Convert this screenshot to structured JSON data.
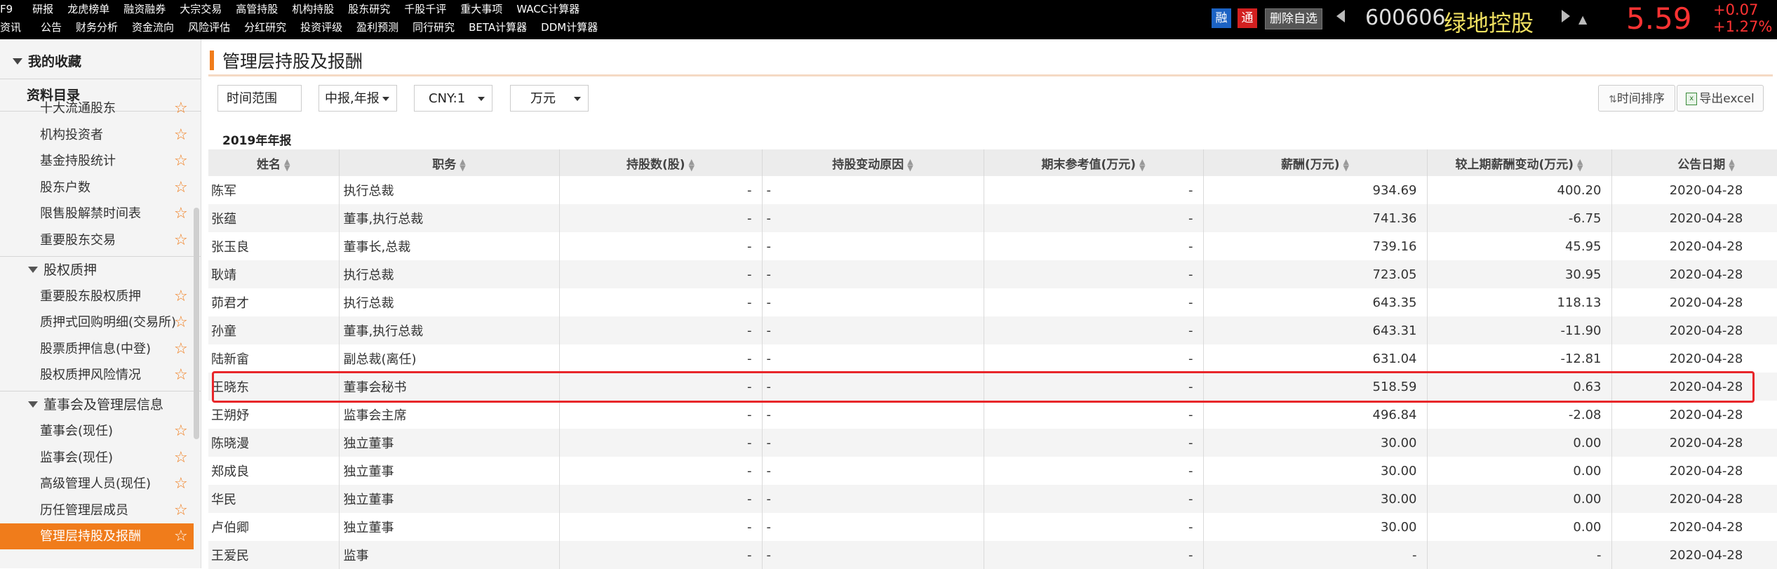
{
  "topbar": {
    "row1": [
      "F9",
      "研报",
      "龙虎榜单",
      "融资融券",
      "大宗交易",
      "高管持股",
      "机构持股",
      "股东研究",
      "千股千评",
      "重大事项",
      "WACC计算器"
    ],
    "row2": [
      "资讯",
      "公告",
      "财务分析",
      "资金流向",
      "风险评估",
      "分红研究",
      "投资评级",
      "盈利预测",
      "同行研究",
      "BETA计算器",
      "DDM计算器"
    ],
    "badge_rong": "融",
    "badge_tong": "通",
    "remove_watchlist": "删除自选",
    "stock_code": "600606",
    "stock_name": "绿地控股",
    "price": "5.59",
    "change_abs": "+0.07",
    "change_pct": "+1.27%"
  },
  "sidebar": {
    "favorites": "我的收藏",
    "catalog": "资料目录",
    "items_top": [
      "十大流通股东",
      "机构投资者",
      "基金持股统计",
      "股东户数",
      "限售股解禁时间表",
      "重要股东交易"
    ],
    "group_pledge": "股权质押",
    "items_pledge": [
      "重要股东股权质押",
      "质押式回购明细(交易所)",
      "股票质押信息(中登)",
      "股权质押风险情况"
    ],
    "group_board": "董事会及管理层信息",
    "items_board": [
      "董事会(现任)",
      "监事会(现任)",
      "高级管理人员(现任)",
      "历任管理层成员",
      "管理层持股及报酬"
    ],
    "active_item": "管理层持股及报酬"
  },
  "main": {
    "title": "管理层持股及报酬",
    "time_range": "时间范围",
    "period_select": "中报,年报",
    "currency_select": "CNY:1",
    "unit_select": "万元",
    "sort_by_time": "时间排序",
    "export_excel": "导出excel",
    "section": "2019年年报",
    "columns": [
      "姓名",
      "职务",
      "持股数(股)",
      "持股变动原因",
      "期末参考值(万元)",
      "薪酬(万元)",
      "较上期薪酬变动(万元)",
      "公告日期"
    ],
    "rows": [
      [
        "陈军",
        "执行总裁",
        "-",
        "-",
        "-",
        "934.69",
        "400.20",
        "2020-04-28"
      ],
      [
        "张蕴",
        "董事,执行总裁",
        "-",
        "-",
        "-",
        "741.36",
        "-6.75",
        "2020-04-28"
      ],
      [
        "张玉良",
        "董事长,总裁",
        "-",
        "-",
        "-",
        "739.16",
        "45.95",
        "2020-04-28"
      ],
      [
        "耿靖",
        "执行总裁",
        "-",
        "-",
        "-",
        "723.05",
        "30.95",
        "2020-04-28"
      ],
      [
        "茆君才",
        "执行总裁",
        "-",
        "-",
        "-",
        "643.35",
        "118.13",
        "2020-04-28"
      ],
      [
        "孙童",
        "董事,执行总裁",
        "-",
        "-",
        "-",
        "643.31",
        "-11.90",
        "2020-04-28"
      ],
      [
        "陆新畲",
        "副总裁(离任)",
        "-",
        "-",
        "-",
        "631.04",
        "-12.81",
        "2020-04-28"
      ],
      [
        "王晓东",
        "董事会秘书",
        "-",
        "-",
        "-",
        "518.59",
        "0.63",
        "2020-04-28"
      ],
      [
        "王朔妤",
        "监事会主席",
        "-",
        "-",
        "-",
        "496.84",
        "-2.08",
        "2020-04-28"
      ],
      [
        "陈晓漫",
        "独立董事",
        "-",
        "-",
        "-",
        "30.00",
        "0.00",
        "2020-04-28"
      ],
      [
        "郑成良",
        "独立董事",
        "-",
        "-",
        "-",
        "30.00",
        "0.00",
        "2020-04-28"
      ],
      [
        "华民",
        "独立董事",
        "-",
        "-",
        "-",
        "30.00",
        "0.00",
        "2020-04-28"
      ],
      [
        "卢伯卿",
        "独立董事",
        "-",
        "-",
        "-",
        "30.00",
        "0.00",
        "2020-04-28"
      ],
      [
        "王爱民",
        "监事",
        "-",
        "-",
        "-",
        "-",
        "-",
        "2020-04-28"
      ]
    ]
  },
  "colors": {
    "accent": "#f07c1b",
    "highlight_border": "#e8262a",
    "price_red": "#ff3333",
    "stock_name": "#f0e060"
  },
  "icons": {
    "favorite": "star-outline-icon",
    "sort": "sort-updown-icon",
    "export": "excel-icon"
  }
}
